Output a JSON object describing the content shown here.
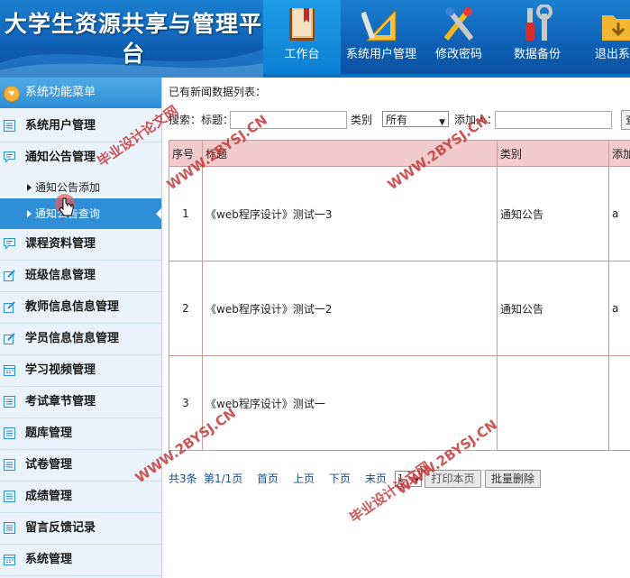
{
  "app": {
    "title": "大学生资源共享与管理平台"
  },
  "nav": [
    {
      "label": "工作台",
      "icon": "book-icon",
      "active": true
    },
    {
      "label": "系统用户管理",
      "icon": "drafting-ruler-icon"
    },
    {
      "label": "修改密码",
      "icon": "tools-icon"
    },
    {
      "label": "数据备份",
      "icon": "screwdriver-wrench-icon"
    },
    {
      "label": "退出系统",
      "icon": "folder-exit-icon"
    }
  ],
  "sidebar": {
    "title": "系统功能菜单",
    "items": [
      {
        "label": "系统用户管理",
        "icon": "list-icon"
      },
      {
        "label": "通知公告管理",
        "icon": "message-icon"
      },
      {
        "label": "课程资料管理",
        "icon": "message-icon"
      },
      {
        "label": "班级信息管理",
        "icon": "edit-icon"
      },
      {
        "label": "教师信息信息管理",
        "icon": "edit-icon"
      },
      {
        "label": "学员信息信息管理",
        "icon": "edit-icon"
      },
      {
        "label": "学习视频管理",
        "icon": "calendar-icon"
      },
      {
        "label": "考试章节管理",
        "icon": "list-icon"
      },
      {
        "label": "题库管理",
        "icon": "list-icon"
      },
      {
        "label": "试卷管理",
        "icon": "list-icon"
      },
      {
        "label": "成绩管理",
        "icon": "list-icon"
      },
      {
        "label": "留言反馈记录",
        "icon": "list-icon"
      },
      {
        "label": "系统管理",
        "icon": "calendar-icon"
      }
    ],
    "subitems": [
      {
        "label": "通知公告添加",
        "active": false
      },
      {
        "label": "通知公告查询",
        "active": true
      }
    ]
  },
  "main": {
    "list_caption": "已有新闻数据列表：",
    "search": {
      "prefix": "搜索：标题：",
      "category_label": "类别",
      "category_value": "所有",
      "adder_label": "添加人：",
      "button": "查"
    },
    "table": {
      "headers": [
        "序号",
        "标题",
        "类别",
        "添加"
      ],
      "rows": [
        {
          "no": "1",
          "title": "《web程序设计》测试一3",
          "category": "通知公告",
          "adder": "a"
        },
        {
          "no": "2",
          "title": "《web程序设计》测试一2",
          "category": "通知公告",
          "adder": "a"
        },
        {
          "no": "3",
          "title": "《web程序设计》测试一",
          "category": "",
          "adder": ""
        }
      ]
    },
    "pager": {
      "total": "共3条",
      "page_info": "第1/1页",
      "first": "首页",
      "prev": "上页",
      "next": "下页",
      "last": "末页",
      "page_select": "1",
      "print_button": "打印本页",
      "batch_delete_button": "批量删除"
    }
  },
  "watermarks": [
    "WWW.2BYSJ.CN",
    "毕业设计论文网"
  ],
  "colors": {
    "header": "#0e5fb4",
    "sidebar_bg": "#eaf3fb",
    "active": "#2f8fd6",
    "table_header": "#f2cccc"
  }
}
